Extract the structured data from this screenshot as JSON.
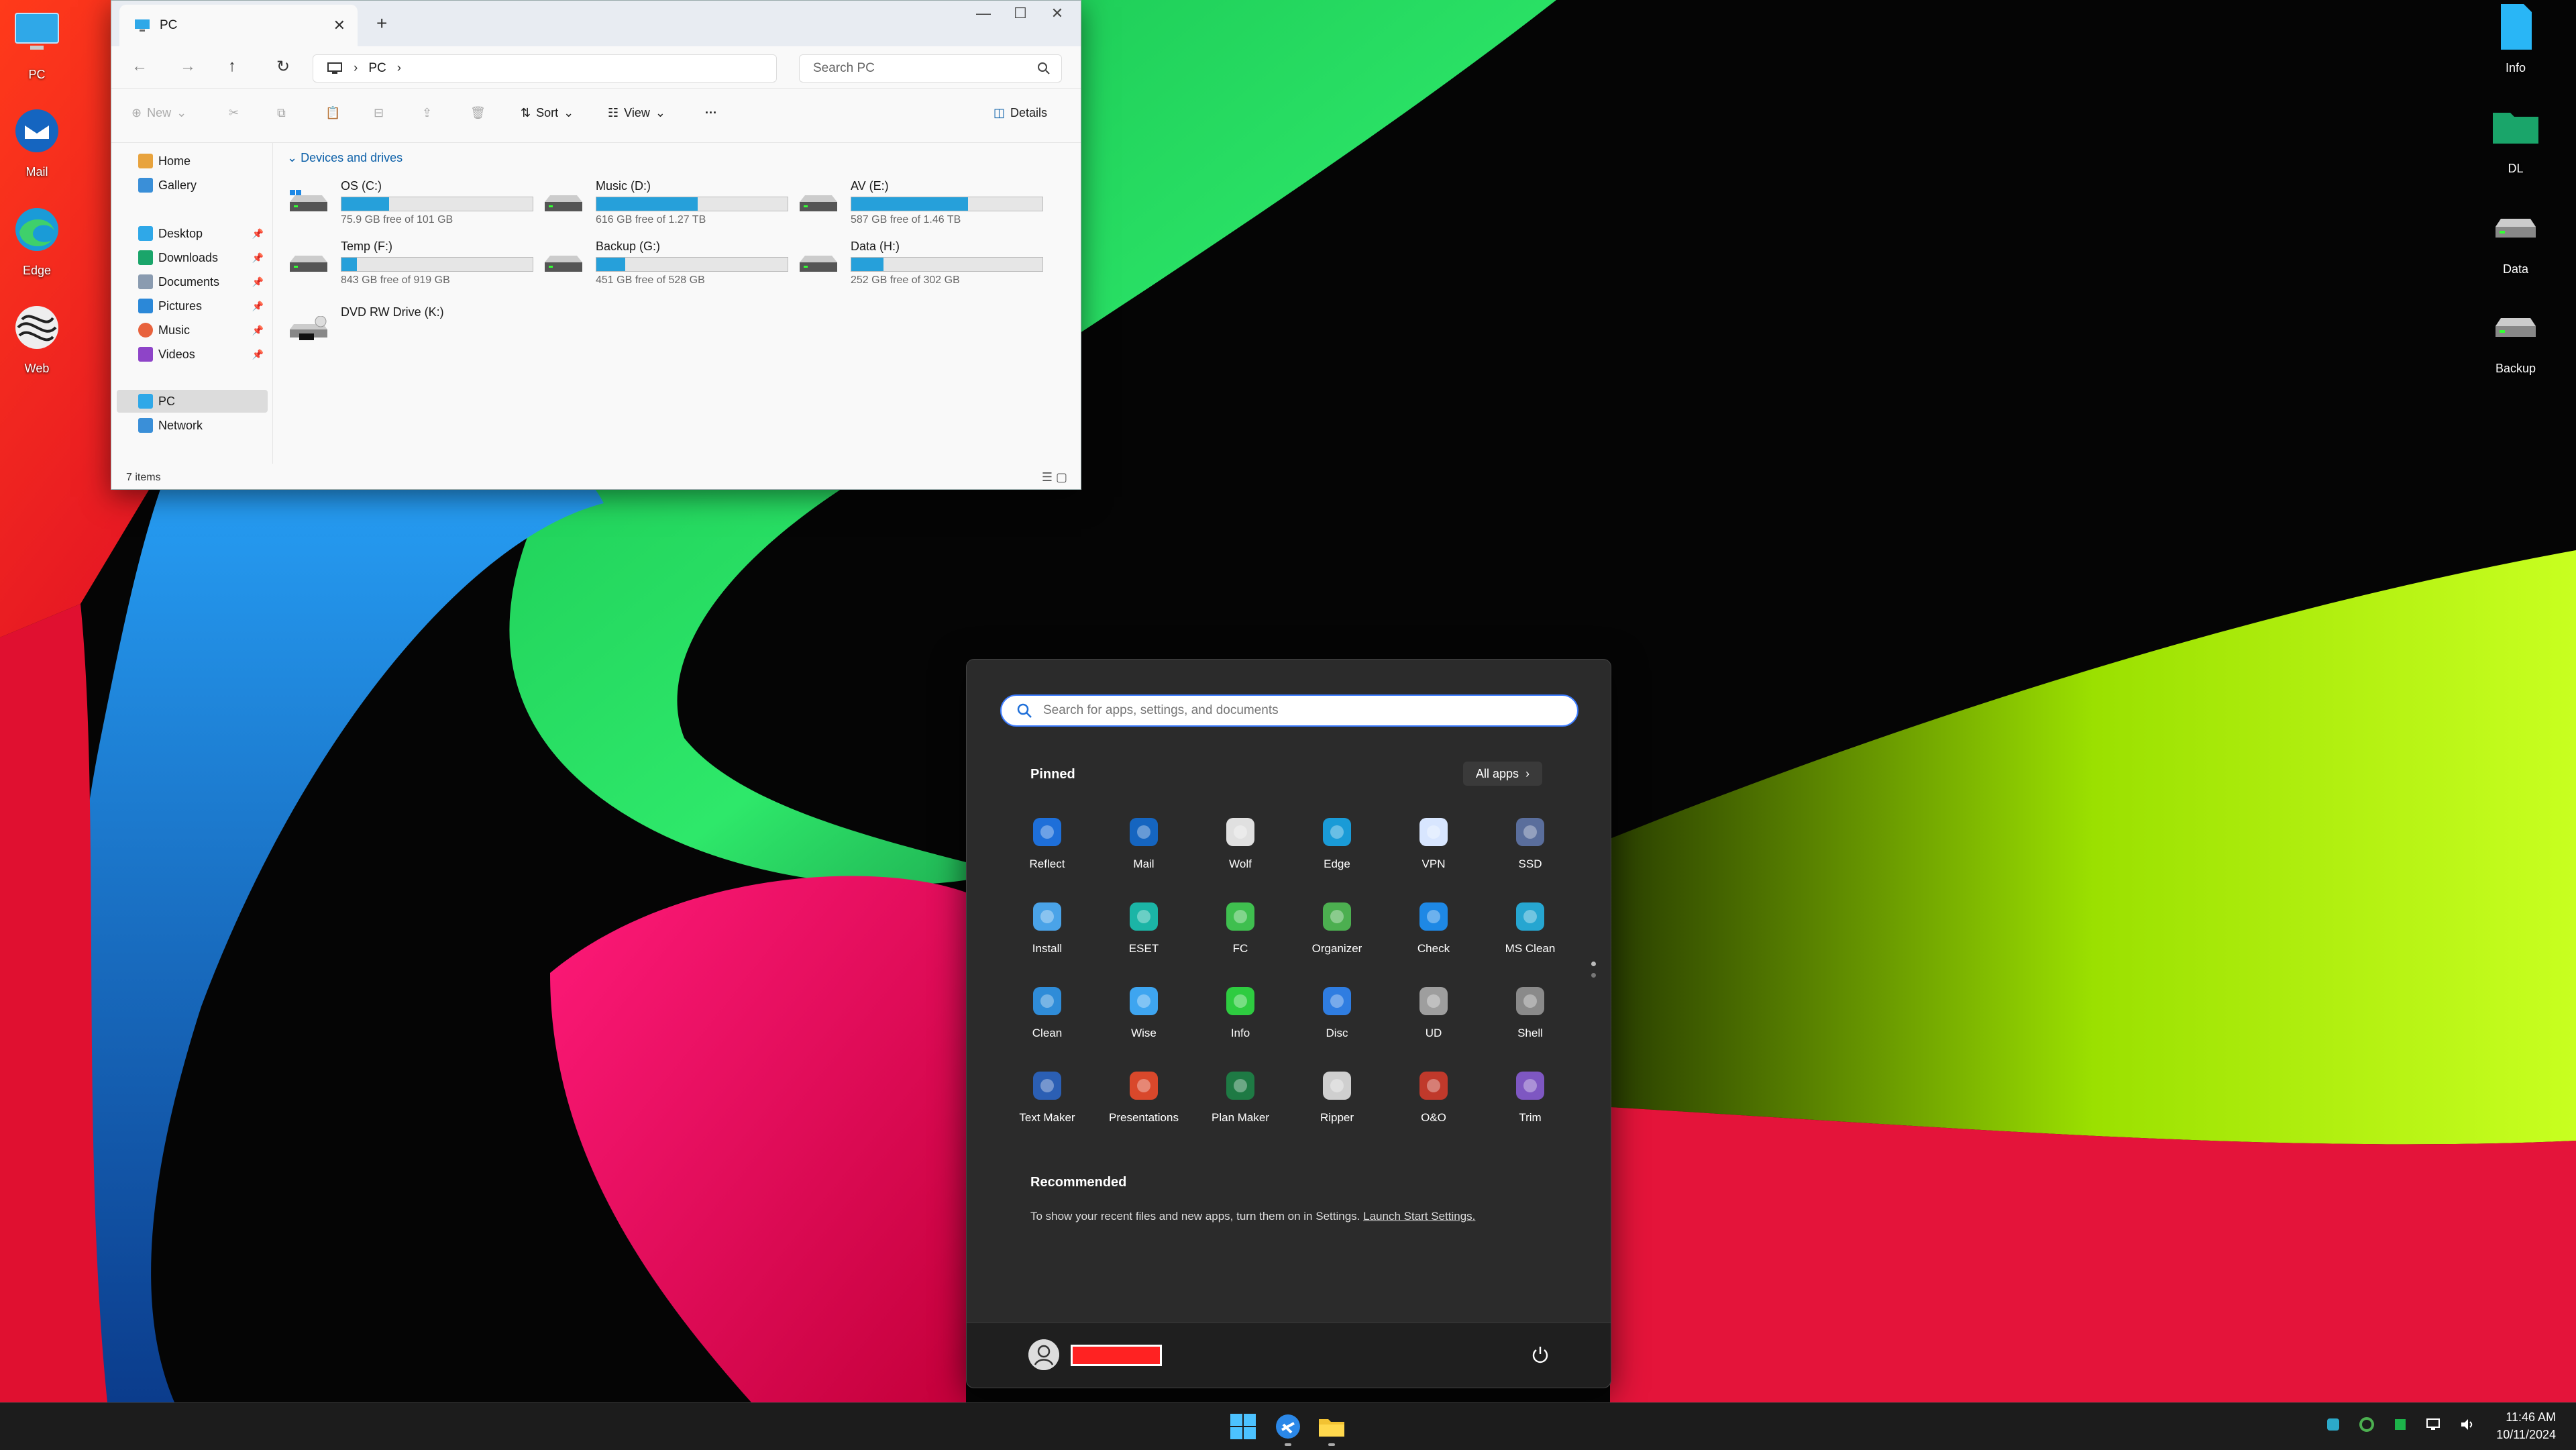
{
  "desktop": {
    "left_icons": [
      {
        "label": "PC",
        "icon": "monitor-icon"
      },
      {
        "label": "Mail",
        "icon": "mail-icon"
      },
      {
        "label": "Edge",
        "icon": "edge-icon"
      },
      {
        "label": "Web",
        "icon": "web-icon"
      }
    ],
    "right_icons": [
      {
        "label": "Info",
        "icon": "file-icon"
      },
      {
        "label": "DL",
        "icon": "folder-icon"
      },
      {
        "label": "Data",
        "icon": "drive-icon"
      },
      {
        "label": "Backup",
        "icon": "drive-icon"
      }
    ]
  },
  "explorer": {
    "tab_title": "PC",
    "address": "PC",
    "search_placeholder": "Search PC",
    "toolbar": {
      "new": "New",
      "sort": "Sort",
      "view": "View",
      "more": "···",
      "details": "Details"
    },
    "nav": {
      "top": [
        "Home",
        "Gallery"
      ],
      "quick": [
        "Desktop",
        "Downloads",
        "Documents",
        "Pictures",
        "Music",
        "Videos"
      ],
      "bottom": [
        "PC",
        "Network"
      ]
    },
    "group_header": "Devices and drives",
    "drives": [
      {
        "name": "OS (C:)",
        "free": "75.9 GB free of 101 GB",
        "used_fraction": 0.25
      },
      {
        "name": "Music (D:)",
        "free": "616 GB free of 1.27 TB",
        "used_fraction": 0.53
      },
      {
        "name": "AV (E:)",
        "free": "587 GB free of 1.46 TB",
        "used_fraction": 0.61
      },
      {
        "name": "Temp (F:)",
        "free": "843 GB free of 919 GB",
        "used_fraction": 0.08
      },
      {
        "name": "Backup (G:)",
        "free": "451 GB free of 528 GB",
        "used_fraction": 0.15
      },
      {
        "name": "Data (H:)",
        "free": "252 GB free of 302 GB",
        "used_fraction": 0.17
      },
      {
        "name": "DVD RW Drive (K:)",
        "free": "",
        "used_fraction": 0
      }
    ],
    "status": "7 items"
  },
  "start": {
    "search_placeholder": "Search for apps, settings, and documents",
    "pinned_title": "Pinned",
    "all_apps": "All apps",
    "apps": [
      {
        "label": "Reflect",
        "color": "#1e6fd9"
      },
      {
        "label": "Mail",
        "color": "#1565c0"
      },
      {
        "label": "Wolf",
        "color": "#e0e0e0"
      },
      {
        "label": "Edge",
        "color": "#1a9bd7"
      },
      {
        "label": "VPN",
        "color": "#d8e6ff"
      },
      {
        "label": "SSD",
        "color": "#5a6e9c"
      },
      {
        "label": "Install",
        "color": "#4aa3e8"
      },
      {
        "label": "ESET",
        "color": "#1bb5a6"
      },
      {
        "label": "FC",
        "color": "#3fbf4f"
      },
      {
        "label": "Organizer",
        "color": "#4caf50"
      },
      {
        "label": "Check",
        "color": "#1e88e5"
      },
      {
        "label": "MS Clean",
        "color": "#26a6d1"
      },
      {
        "label": "Clean",
        "color": "#2f8cd8"
      },
      {
        "label": "Wise",
        "color": "#3ea5f0"
      },
      {
        "label": "Info",
        "color": "#2ecc40"
      },
      {
        "label": "Disc",
        "color": "#2f7de1"
      },
      {
        "label": "UD",
        "color": "#9e9e9e"
      },
      {
        "label": "Shell",
        "color": "#8a8a8a"
      },
      {
        "label": "Text Maker",
        "color": "#2b5fb4"
      },
      {
        "label": "Presentations",
        "color": "#d9482b"
      },
      {
        "label": "Plan Maker",
        "color": "#1e7a44"
      },
      {
        "label": "Ripper",
        "color": "#cfcfcf"
      },
      {
        "label": "O&O",
        "color": "#c0392b"
      },
      {
        "label": "Trim",
        "color": "#7e57c2"
      }
    ],
    "recommended_title": "Recommended",
    "recommended_text": "To show your recent files and new apps, turn them on in Settings.",
    "recommended_link": "Launch Start Settings."
  },
  "taskbar": {
    "time": "11:46 AM",
    "date": "10/11/2024"
  }
}
